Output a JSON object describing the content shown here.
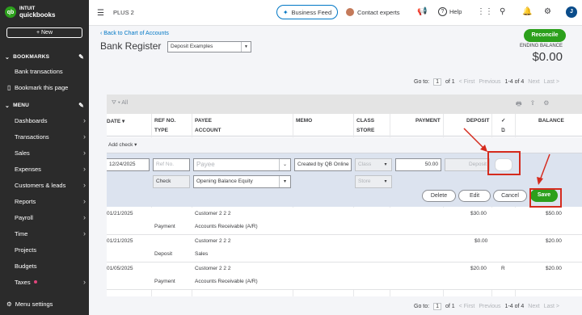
{
  "sidebar": {
    "logo_badge": "qb",
    "logo_brand": "INTUIT",
    "logo_name": "quickbooks",
    "new_label": "+ New",
    "bookmarks_header": "BOOKMARKS",
    "bookmarks": [
      "Bank transactions",
      "Bookmark this page"
    ],
    "menu_header": "MENU",
    "menu_items": [
      "Dashboards",
      "Transactions",
      "Sales",
      "Expenses",
      "Customers & leads",
      "Reports",
      "Payroll",
      "Time",
      "Projects",
      "Budgets",
      "Taxes"
    ],
    "menu_settings": "Menu settings"
  },
  "topbar": {
    "plan": "PLUS 2",
    "business_feed": "Business Feed",
    "contact": "Contact experts",
    "help": "Help",
    "user_initial": "J"
  },
  "header": {
    "back_link": "Back to Chart of Accounts",
    "title": "Bank Register",
    "account": "Deposit Examples",
    "reconcile": "Reconcile",
    "ending_balance_label": "ENDING BALANCE",
    "ending_balance": "$0.00"
  },
  "pager": {
    "goto": "Go to:",
    "page": "1",
    "of": "of 1",
    "first": "< First",
    "previous": "Previous",
    "range": "1-4 of 4",
    "next": "Next",
    "last": "Last >"
  },
  "toolbar": {
    "filter": "All"
  },
  "columns": {
    "date": "DATE",
    "ref": "REF NO.",
    "type": "TYPE",
    "payee": "PAYEE",
    "account": "ACCOUNT",
    "memo": "MEMO",
    "class": "CLASS",
    "store": "STORE",
    "payment": "PAYMENT",
    "deposit": "DEPOSIT",
    "check": "✓",
    "balance": "BALANCE"
  },
  "add_check": "Add check",
  "edit_row": {
    "date": "12/24/2025",
    "ref_placeholder": "Ref No.",
    "payee_placeholder": "Payee",
    "memo": "Created by QB Online",
    "class_placeholder": "Class",
    "payment": "50.00",
    "deposit_placeholder": "Deposit",
    "type": "Check",
    "account": "Opening Balance Equity",
    "store_placeholder": "Store",
    "delete": "Delete",
    "edit": "Edit",
    "cancel": "Cancel",
    "save": "Save"
  },
  "rows": [
    {
      "date": "01/21/2025",
      "type": "Payment",
      "payee": "Customer 2 2 2",
      "account": "Accounts Receivable (A/R)",
      "deposit": "$30.00",
      "check": "",
      "balance": "$50.00"
    },
    {
      "date": "01/21/2025",
      "type": "Deposit",
      "payee": "Customer 2 2 2",
      "account": "Sales",
      "deposit": "$0.00",
      "check": "",
      "balance": "$20.00"
    },
    {
      "date": "01/05/2025",
      "type": "Payment",
      "payee": "Customer 2 2 2",
      "account": "Accounts Receivable (A/R)",
      "deposit": "$20.00",
      "check": "R",
      "balance": "$20.00"
    }
  ],
  "colors": {
    "accent_green": "#2ca01c",
    "link_blue": "#0077c5",
    "annotation_red": "#d52b1e"
  }
}
